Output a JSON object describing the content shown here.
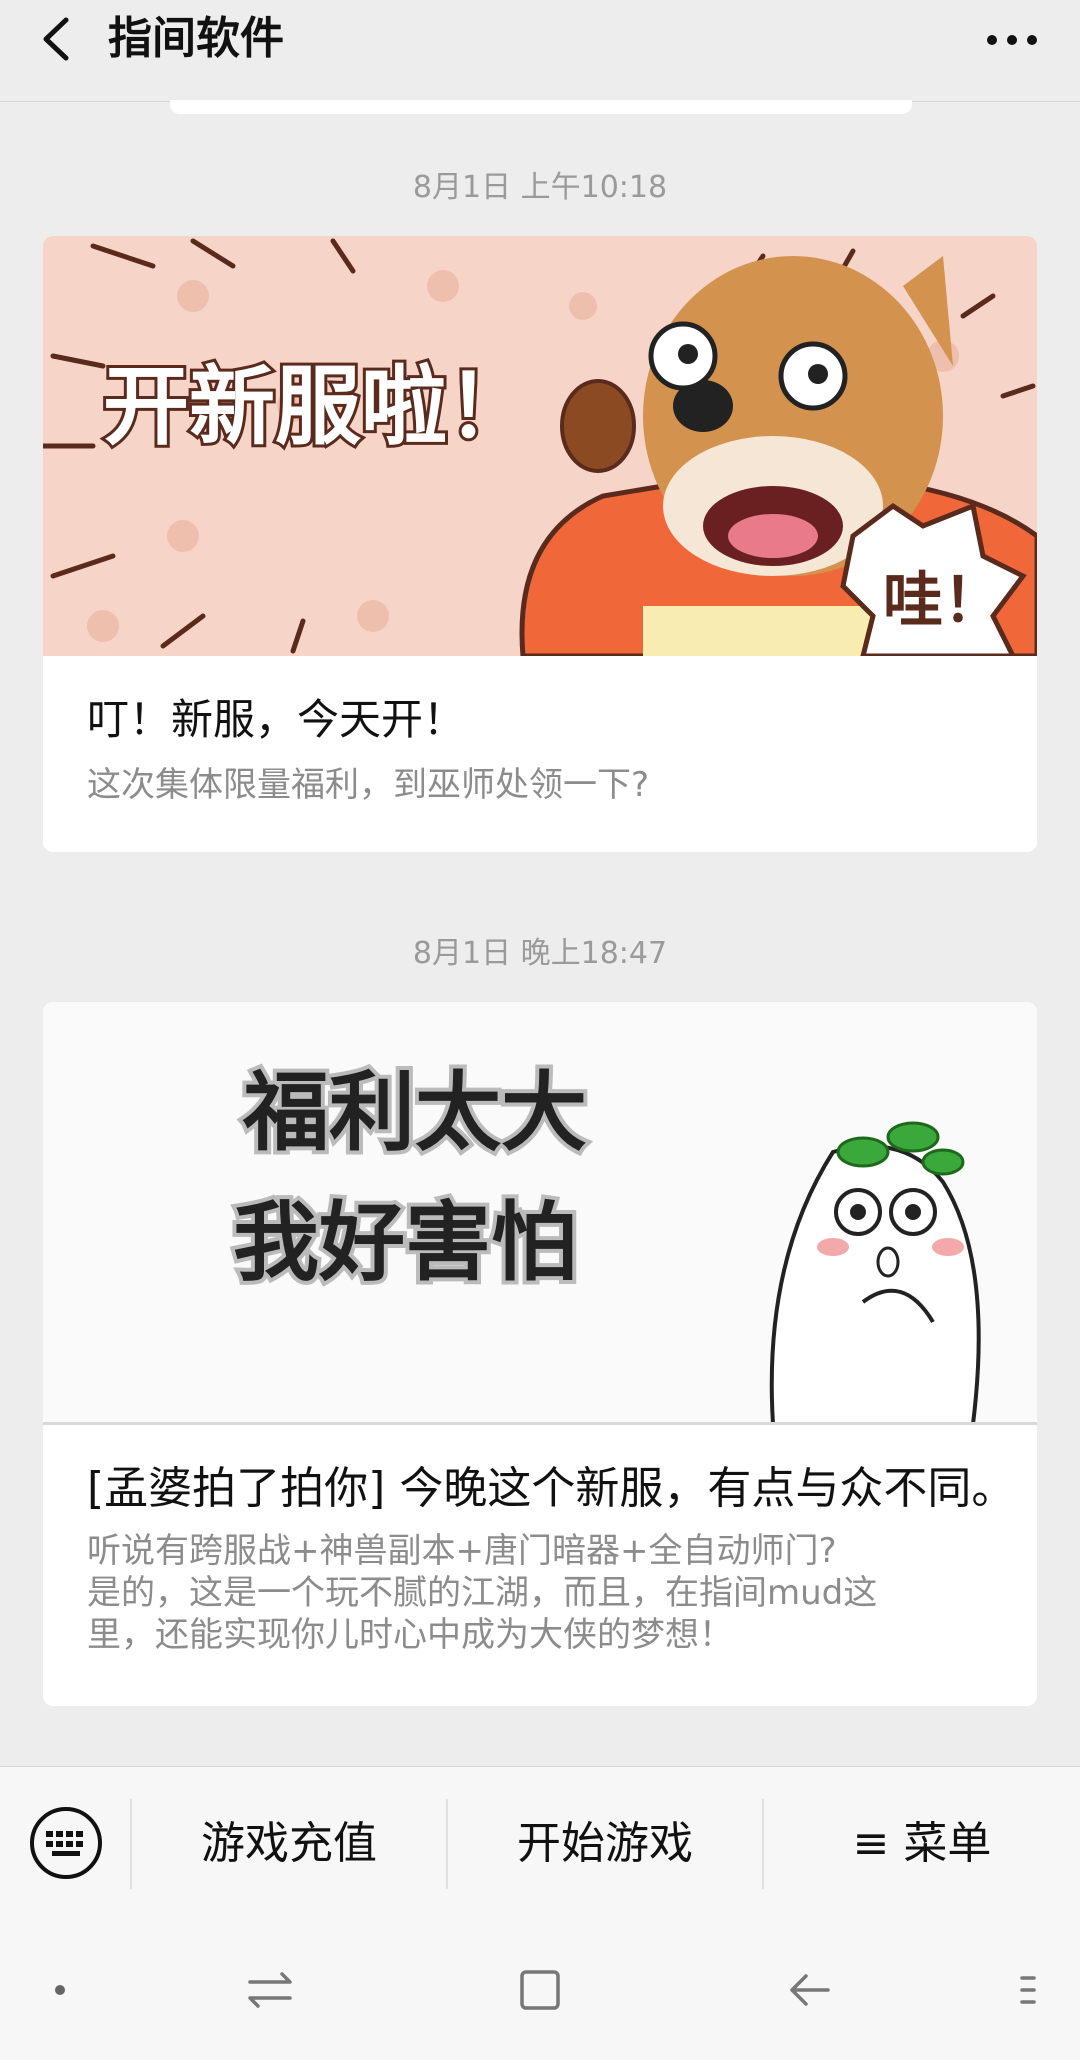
{
  "header": {
    "title": "指间软件",
    "back_icon": "chevron-left-icon",
    "more_icon": "more-dots-icon"
  },
  "messages": [
    {
      "timestamp": "8月1日 上午10:18",
      "banner": {
        "headline": "开新服啦！",
        "exclaim": "哇！"
      },
      "title": "叮！新服，今天开！",
      "description": "这次集体限量福利，到巫师处领一下?"
    },
    {
      "timestamp": "8月1日 晚上18:47",
      "banner": {
        "line1": "福利太大",
        "line2": "我好害怕"
      },
      "title": "[孟婆拍了拍你] 今晚这个新服，有点与众不同。",
      "description_lines": [
        "听说有跨服战+神兽副本+唐门暗器+全自动师门?",
        "是的，这是一个玩不腻的江湖，而且，在指间mud这",
        "里，还能实现你儿时心中成为大侠的梦想！"
      ]
    }
  ],
  "menu": {
    "keyboard_icon": "keyboard-icon",
    "items": [
      "游戏充值",
      "开始游戏",
      "≡ 菜单"
    ]
  },
  "system_nav": {
    "icons": [
      "dot-icon",
      "switch-arrows-icon",
      "square-home-icon",
      "back-arrow-icon",
      "menu-lines-icon"
    ]
  },
  "colors": {
    "background": "#ededed",
    "card": "#ffffff",
    "muted_text": "#8c8c8c",
    "banner1_bg": "#f6d5c8",
    "banner_accent": "#f0683a"
  }
}
